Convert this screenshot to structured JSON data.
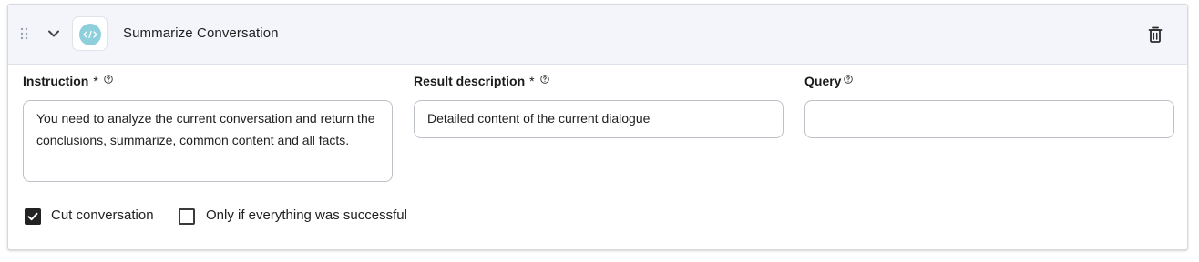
{
  "step": {
    "title": "Summarize Conversation",
    "type_icon": "code-icon",
    "accent_color": "#8ecfdc"
  },
  "fields": {
    "instruction": {
      "label": "Instruction",
      "required_mark": "*",
      "value": "You need to analyze the current conversation and return the conclusions, summarize, common content and all facts."
    },
    "result_description": {
      "label": "Result description",
      "required_mark": "*",
      "value": "Detailed content of the current dialogue"
    },
    "query": {
      "label": "Query",
      "value": ""
    }
  },
  "options": {
    "cut_conversation": {
      "label": "Cut conversation",
      "checked": true
    },
    "only_if_successful": {
      "label": "Only if everything was successful",
      "checked": false
    }
  }
}
